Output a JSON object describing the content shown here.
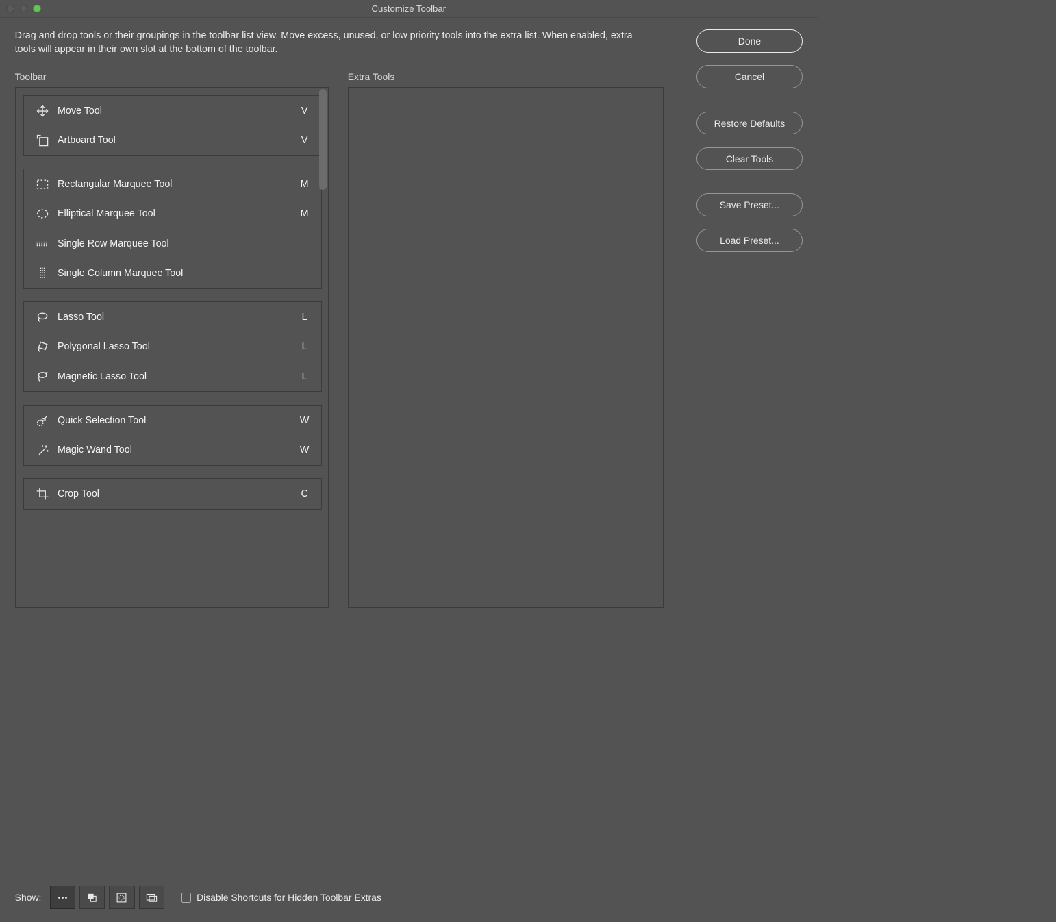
{
  "window": {
    "title": "Customize Toolbar"
  },
  "instructions": "Drag and drop tools or their groupings in the toolbar list view. Move excess, unused, or low priority tools into the extra list. When enabled, extra tools will appear in their own slot at the bottom of the toolbar.",
  "labels": {
    "toolbar": "Toolbar",
    "extras": "Extra Tools",
    "show": "Show:",
    "disable_shortcuts": "Disable Shortcuts for Hidden Toolbar Extras"
  },
  "buttons": {
    "done": "Done",
    "cancel": "Cancel",
    "restore_defaults": "Restore Defaults",
    "clear_tools": "Clear Tools",
    "save_preset": "Save Preset...",
    "load_preset": "Load Preset..."
  },
  "toolbar_groups": [
    {
      "tools": [
        {
          "icon": "move",
          "name": "Move Tool",
          "shortcut": "V"
        },
        {
          "icon": "artboard",
          "name": "Artboard Tool",
          "shortcut": "V"
        }
      ]
    },
    {
      "tools": [
        {
          "icon": "rect-marquee",
          "name": "Rectangular Marquee Tool",
          "shortcut": "M"
        },
        {
          "icon": "ellipse-marquee",
          "name": "Elliptical Marquee Tool",
          "shortcut": "M"
        },
        {
          "icon": "row-marquee",
          "name": "Single Row Marquee Tool",
          "shortcut": ""
        },
        {
          "icon": "col-marquee",
          "name": "Single Column Marquee Tool",
          "shortcut": ""
        }
      ]
    },
    {
      "tools": [
        {
          "icon": "lasso",
          "name": "Lasso Tool",
          "shortcut": "L"
        },
        {
          "icon": "poly-lasso",
          "name": "Polygonal Lasso Tool",
          "shortcut": "L"
        },
        {
          "icon": "mag-lasso",
          "name": "Magnetic Lasso Tool",
          "shortcut": "L"
        }
      ]
    },
    {
      "tools": [
        {
          "icon": "quick-select",
          "name": "Quick Selection Tool",
          "shortcut": "W"
        },
        {
          "icon": "magic-wand",
          "name": "Magic Wand Tool",
          "shortcut": "W"
        }
      ]
    },
    {
      "tools": [
        {
          "icon": "crop",
          "name": "Crop Tool",
          "shortcut": "C"
        }
      ]
    }
  ],
  "footer_toggles": [
    {
      "icon": "ellipsis",
      "active": true
    },
    {
      "icon": "fgbg-swatch",
      "active": false
    },
    {
      "icon": "quickmask",
      "active": false
    },
    {
      "icon": "screenmode",
      "active": false
    }
  ],
  "disable_shortcuts_checked": false
}
